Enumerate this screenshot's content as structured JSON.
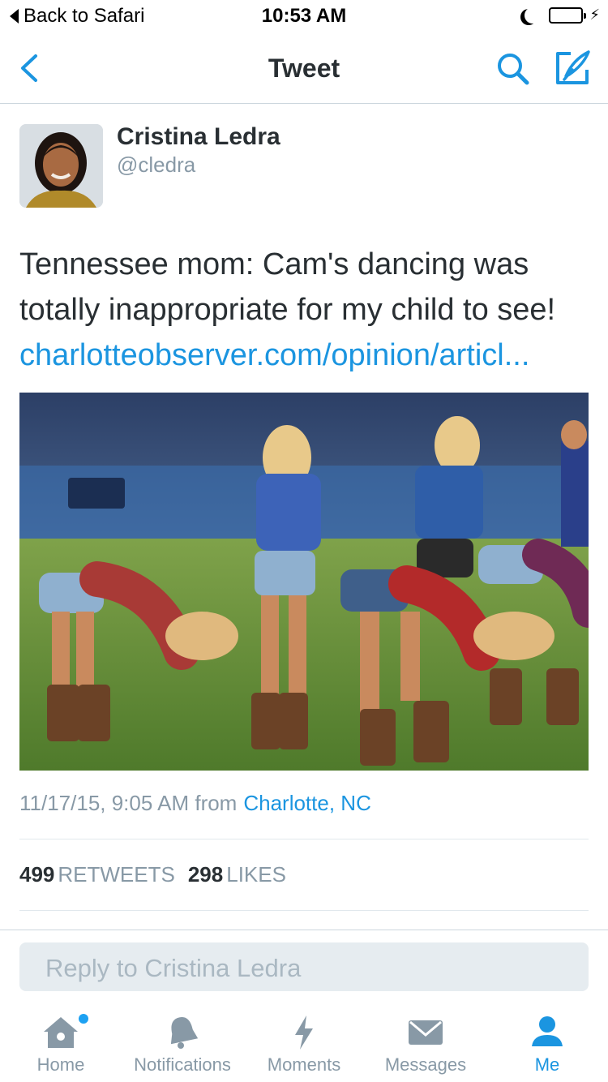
{
  "status_bar": {
    "back_label": "Back to Safari",
    "time": "10:53 AM",
    "battery_color": "#4cd964"
  },
  "nav": {
    "title": "Tweet",
    "back_icon": "chevron-left-icon",
    "search_icon": "search-icon",
    "compose_icon": "compose-icon",
    "accent": "#1b95e0"
  },
  "tweet": {
    "name": "Cristina Ledra",
    "handle": "@cledra",
    "text_line1": "Tennessee mom: Cam's dancing was",
    "text_line2": "totally inappropriate for my child to see!",
    "link": "charlotteobserver.com/opinion/articl...",
    "timestamp": "11/17/15, 9:05 AM from",
    "location": "Charlotte, NC",
    "retweets_count": "499",
    "retweets_label": "RETWEETS",
    "likes_count": "298",
    "likes_label": "LIKES"
  },
  "reply": {
    "placeholder": "Reply to Cristina Ledra"
  },
  "tabbar": {
    "items": [
      {
        "label": "Home",
        "icon": "home-icon"
      },
      {
        "label": "Notifications",
        "icon": "bell-icon"
      },
      {
        "label": "Moments",
        "icon": "lightning-icon"
      },
      {
        "label": "Messages",
        "icon": "envelope-icon"
      },
      {
        "label": "Me",
        "icon": "person-icon"
      }
    ],
    "active": "Me"
  }
}
